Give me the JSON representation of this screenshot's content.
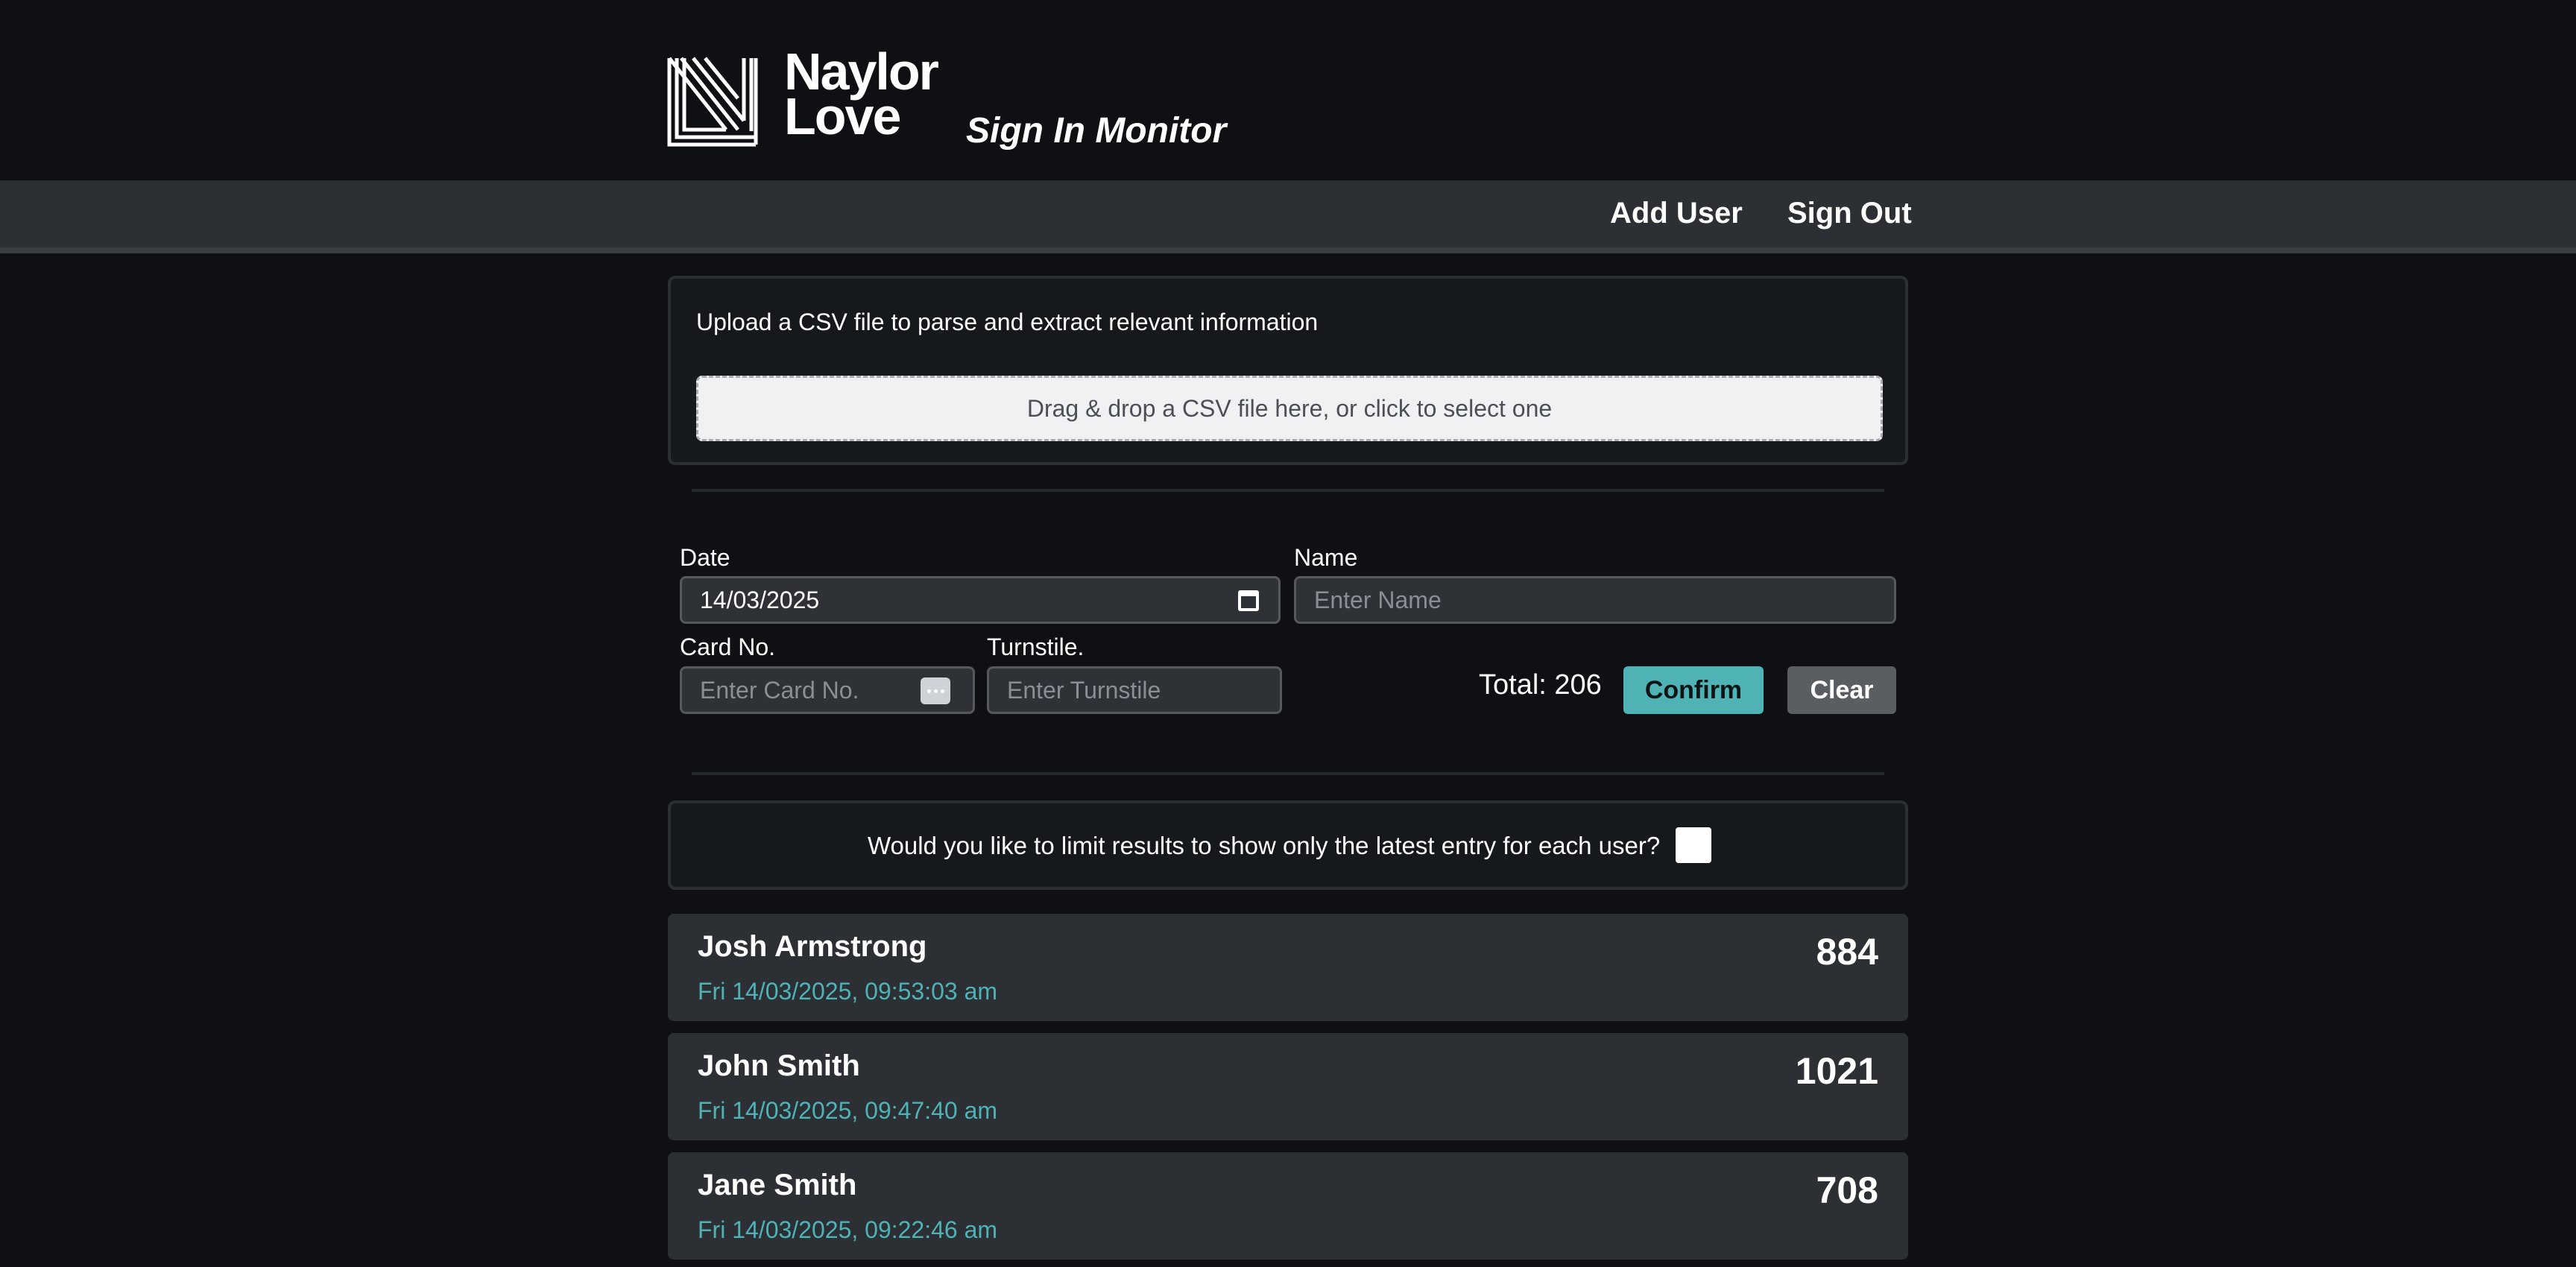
{
  "header": {
    "brand_line1": "Naylor",
    "brand_line2": "Love",
    "app_title": "Sign In Monitor",
    "logo_icon": "naylor-love-logo-icon"
  },
  "nav": {
    "add_user": "Add User",
    "sign_out": "Sign Out"
  },
  "upload": {
    "instructions": "Upload a CSV file to parse and extract relevant information",
    "dropzone_text": "Drag & drop a CSV file here, or click to select one"
  },
  "filters": {
    "date_label": "Date",
    "date_value": "14/03/2025",
    "name_label": "Name",
    "name_placeholder": "Enter Name",
    "card_label": "Card No.",
    "card_placeholder": "Enter Card No.",
    "turnstile_label": "Turnstile.",
    "turnstile_placeholder": "Enter Turnstile",
    "total_text": "Total: 206",
    "confirm_label": "Confirm",
    "clear_label": "Clear"
  },
  "limit": {
    "question": "Would you like to limit results to show only the latest entry for each user?",
    "checked": false
  },
  "entries": [
    {
      "name": "Josh Armstrong",
      "timestamp": "Fri 14/03/2025, 09:53:03 am",
      "card": "884"
    },
    {
      "name": "John Smith",
      "timestamp": "Fri 14/03/2025, 09:47:40 am",
      "card": "1021"
    },
    {
      "name": "Jane Smith",
      "timestamp": "Fri 14/03/2025, 09:22:46 am",
      "card": "708"
    }
  ],
  "colors": {
    "accent": "#4fb3b6",
    "background": "#0e1013",
    "panel": "#2c2f33"
  }
}
